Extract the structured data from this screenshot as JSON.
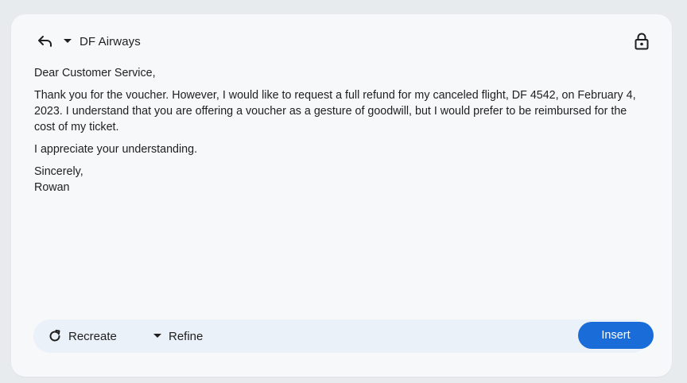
{
  "header": {
    "reply_icon": "reply-icon",
    "dropdown_icon": "caret-down-icon",
    "recipient": "DF Airways",
    "lock_icon": "lock-icon"
  },
  "message": {
    "greeting": "Dear Customer Service,",
    "paragraph_1": "Thank you for the voucher. However, I would like to request a full refund for my canceled flight, DF 4542, on February 4, 2023. I understand that you are offering a voucher as a gesture of goodwill, but I would prefer to be reimbursed for the cost of my ticket.",
    "paragraph_2": "I appreciate your understanding.",
    "closing": "Sincerely,",
    "signature": "Rowan"
  },
  "actions": {
    "recreate_label": "Recreate",
    "refine_label": "Refine",
    "insert_label": "Insert"
  },
  "colors": {
    "accent": "#1a6dd8",
    "card_background": "#f6f8fa",
    "bar_background": "#ebf1f8",
    "page_background": "#e8ebee"
  }
}
